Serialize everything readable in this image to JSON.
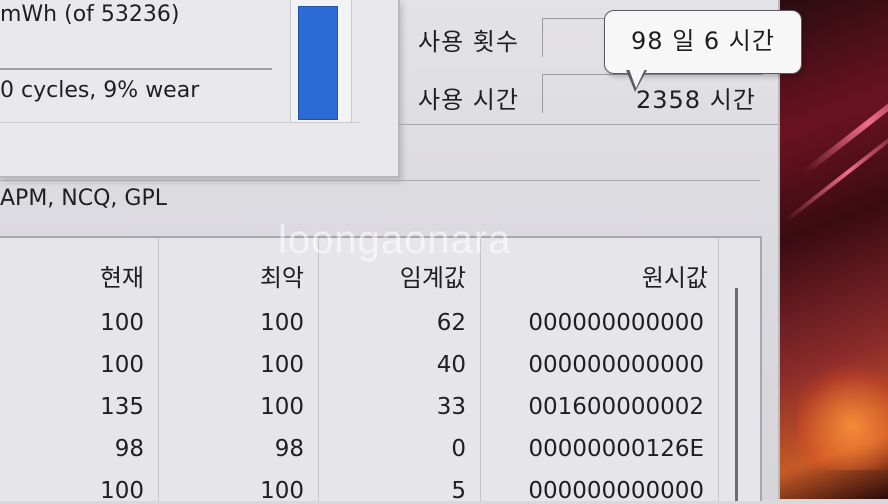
{
  "battery": {
    "capacity_text": "mWh (of 53236)",
    "cycles_text": "0 cycles,  9% wear",
    "level_fraction": 0.95
  },
  "stats": {
    "use_count_label": "사용 횟수",
    "use_count_value": "",
    "use_time_label": "사용 시간",
    "use_time_value": "2358 시간"
  },
  "tooltip": {
    "text": "98 일 6 시간"
  },
  "features": {
    "text": "APM, NCQ, GPL"
  },
  "watermark": "loongaonara",
  "table": {
    "headers": [
      "현재",
      "최악",
      "임계값",
      "원시값"
    ],
    "rows": [
      [
        "100",
        "100",
        "62",
        "000000000000"
      ],
      [
        "100",
        "100",
        "40",
        "000000000000"
      ],
      [
        "135",
        "100",
        "33",
        "001600000002"
      ],
      [
        "98",
        "98",
        "0",
        "00000000126E"
      ],
      [
        "100",
        "100",
        "5",
        "000000000000"
      ]
    ]
  }
}
